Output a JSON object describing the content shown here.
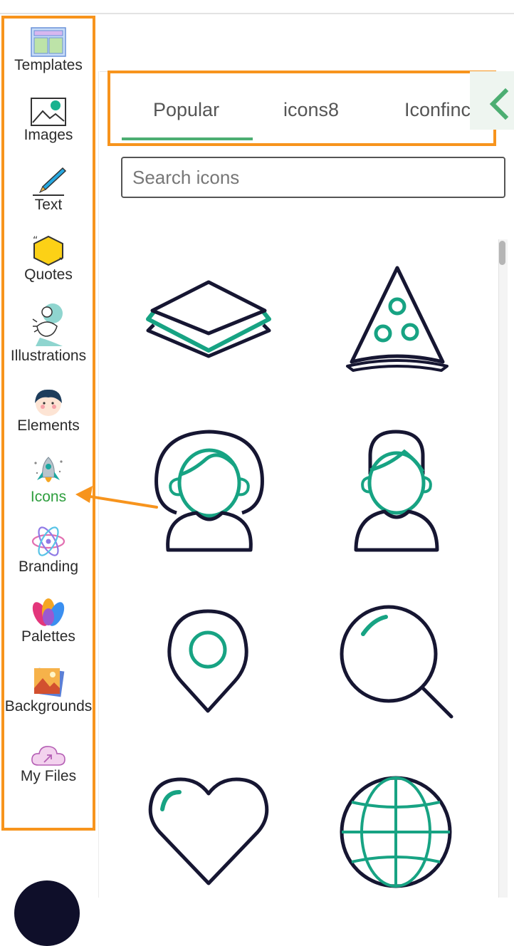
{
  "sidebar": {
    "items": [
      {
        "label": "Templates"
      },
      {
        "label": "Images"
      },
      {
        "label": "Text"
      },
      {
        "label": "Quotes"
      },
      {
        "label": "Illustrations"
      },
      {
        "label": "Elements"
      },
      {
        "label": "Icons"
      },
      {
        "label": "Branding"
      },
      {
        "label": "Palettes"
      },
      {
        "label": "Backgrounds"
      },
      {
        "label": "My Files"
      }
    ],
    "active": "Icons"
  },
  "tabs": [
    {
      "label": "Popular",
      "active": true
    },
    {
      "label": "icons8"
    },
    {
      "label": "Iconfinc"
    }
  ],
  "search": {
    "placeholder": "Search icons"
  },
  "icons": [
    {
      "name": "layers-icon"
    },
    {
      "name": "pizza-slice-icon"
    },
    {
      "name": "woman-user-icon"
    },
    {
      "name": "man-user-icon"
    },
    {
      "name": "location-pin-icon"
    },
    {
      "name": "magnifier-icon"
    },
    {
      "name": "heart-icon"
    },
    {
      "name": "globe-icon"
    }
  ],
  "colors": {
    "highlight": "#f7941d",
    "accent_green": "#2e9e3e",
    "icon_teal": "#17a383",
    "icon_dark": "#161632"
  }
}
